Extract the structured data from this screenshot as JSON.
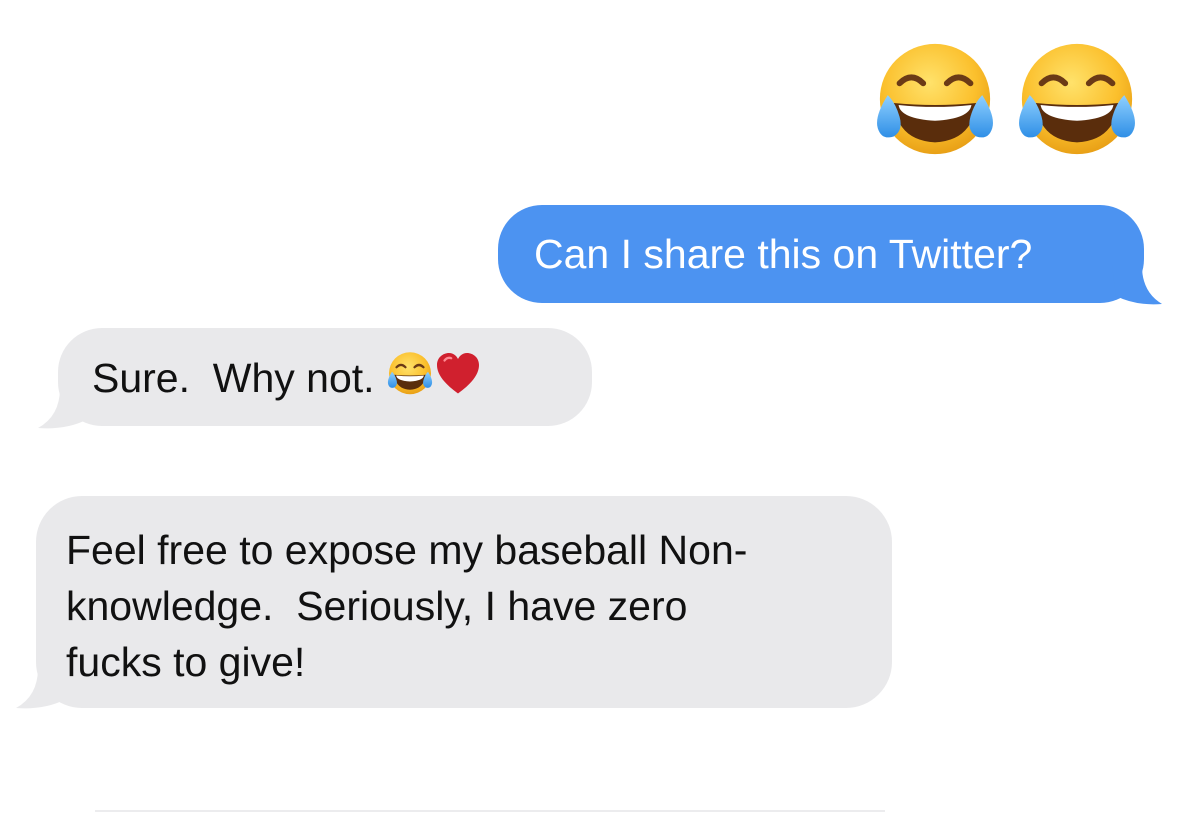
{
  "conversation": {
    "jumbo_emojis": [
      {
        "icon": "face-with-tears-of-joy-icon",
        "glyph": "😂"
      },
      {
        "icon": "face-with-tears-of-joy-icon",
        "glyph": "😂"
      }
    ],
    "messages": [
      {
        "direction": "sent",
        "text": "Can I share this on Twitter?"
      },
      {
        "direction": "received",
        "text": "Sure.  Why not. ",
        "emojis": [
          "face-with-tears-of-joy-icon",
          "red-heart-icon"
        ]
      },
      {
        "direction": "received",
        "lines": [
          "Feel free to expose my baseball Non-",
          "knowledge.  Seriously, I have zero",
          "fucks to give!"
        ]
      }
    ]
  },
  "colors": {
    "sent_bubble": "#4c93f1",
    "received_bubble": "#e9e9eb",
    "sent_text": "#ffffff",
    "received_text": "#111111"
  }
}
